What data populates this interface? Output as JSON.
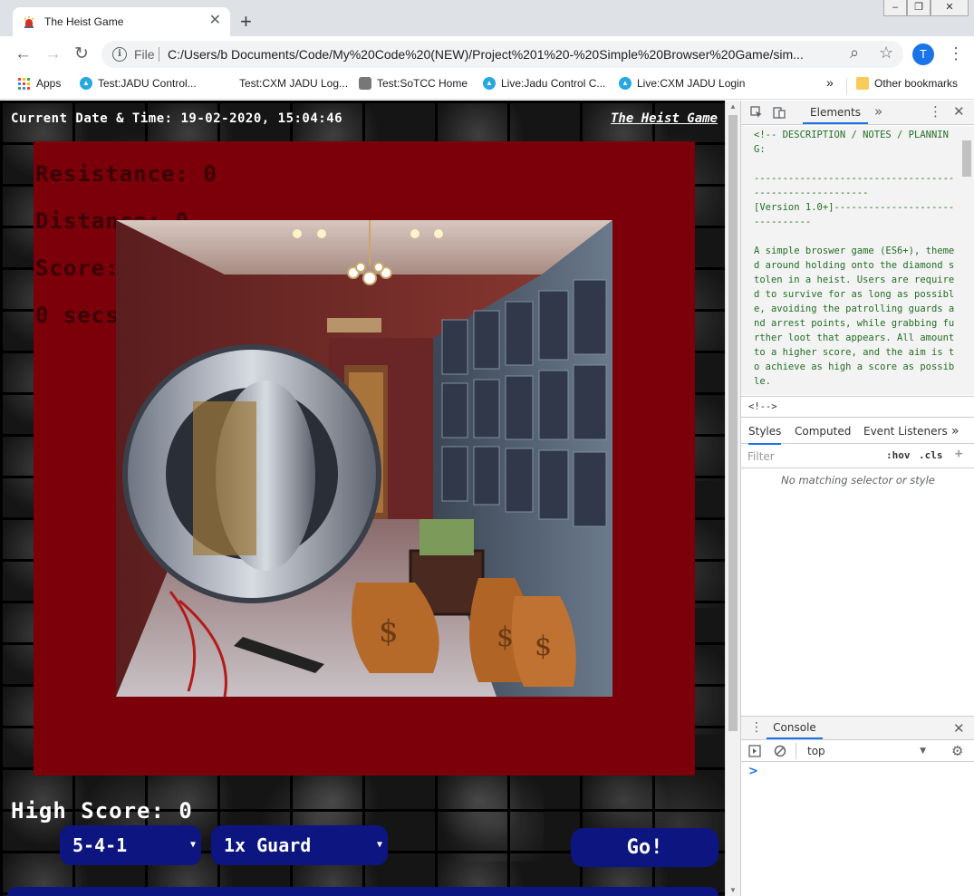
{
  "browser": {
    "tab_title": "The Heist Game",
    "tab_close": "✕",
    "new_tab": "+",
    "window_controls": [
      "‒",
      "❐",
      "✕"
    ],
    "back_icon": "←",
    "forward_icon": "→",
    "reload_icon": "↻",
    "info_icon": "i",
    "scheme_label": "File",
    "url": "C:/Users/b         Documents/Code/My%20Code%20(NEW)/Project%201%20-%20Simple%20Browser%20Game/sim...",
    "zoom_icon": "⌕",
    "star_icon": "☆",
    "profile_initial": "T",
    "menu_icon": "⋮",
    "bookmarks": [
      "Apps",
      "Test:JADU Control...",
      "Test:CXM JADU Log...",
      "Test:SoTCC Home",
      "Live:Jadu Control C...",
      "Live:CXM JADU Login"
    ],
    "bookmarks_overflow": "»",
    "other_bookmarks": "Other bookmarks"
  },
  "game": {
    "datetime_label": "Current Date & Time: 19-02-2020, 15:04:46",
    "title_link": "The Heist Game",
    "stats": {
      "resistance": "Resistance: 0",
      "distance": "Distance: 0",
      "score": "Score: 0",
      "timer": "0 secs"
    },
    "high_score": "High Score: 0",
    "formation_select": "5-4-1",
    "guard_select": "1x Guard",
    "go_button": "Go!",
    "select_caret": "▼"
  },
  "devtools": {
    "tabs": [
      "Elements",
      "»"
    ],
    "code_comment": "<!-- DESCRIPTION / NOTES / PLANNING:\n\n-------------------------------------------------------\n[Version 1.0+]-------------------------------\n\nA simple broswer game (ES6+), themed around holding onto the diamond stolen in a heist. Users are required to survive for as long as possible, avoiding the patrolling guards and arrest points, while grabbing further loot that appears. All amount to a higher score, and the aim is to achieve as high a score as possible.",
    "breadcrumb": "<!-->",
    "subtabs": [
      "Styles",
      "Computed",
      "Event Listeners",
      "»"
    ],
    "filter_placeholder": "Filter",
    "hov": ":hov",
    "cls": ".cls",
    "add": "+",
    "no_match": "No matching selector or style",
    "console_tab": "Console",
    "context": "top",
    "prompt": ">"
  },
  "colors": {
    "board": "#7b0009",
    "button": "#0d1580",
    "devtools_accent": "#1a73e8"
  }
}
